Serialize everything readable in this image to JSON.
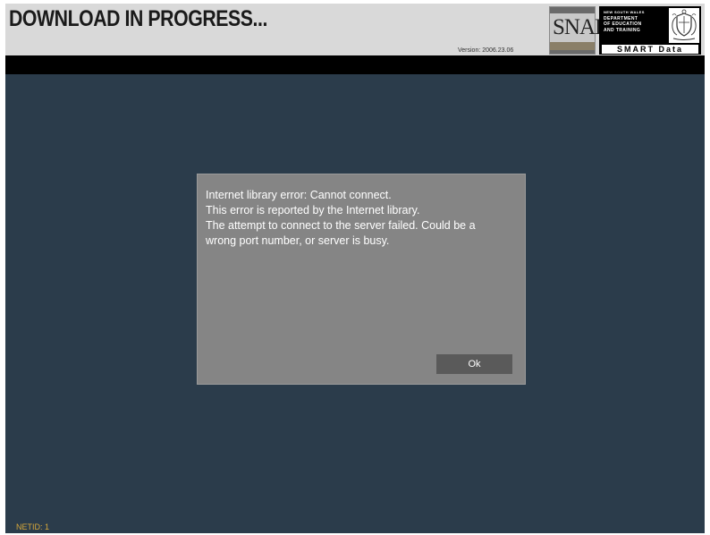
{
  "header": {
    "title": "DOWNLOAD IN PROGRESS...",
    "version": "Version: 2006.23.06",
    "snap_logo_text": "SNAP",
    "dept_logo": {
      "line1": "NEW SOUTH WALES",
      "line2": "DEPARTMENT",
      "line3": "OF EDUCATION",
      "line4": "AND TRAINING",
      "product": "SMART Data"
    }
  },
  "dialog": {
    "message_lines": [
      "Internet library error: Cannot connect.",
      "This error is reported by the Internet library.",
      "The attempt to connect to the server failed. Could be a",
      "wrong port number, or server is busy."
    ],
    "ok_label": "Ok"
  },
  "footer": {
    "netid": "NETID: 1"
  },
  "colors": {
    "header_bg": "#d9d9d9",
    "app_bg": "#2b3c4b",
    "dialog_bg": "#858585",
    "button_bg": "#5a5a5a",
    "netid_text": "#d8a83a"
  }
}
